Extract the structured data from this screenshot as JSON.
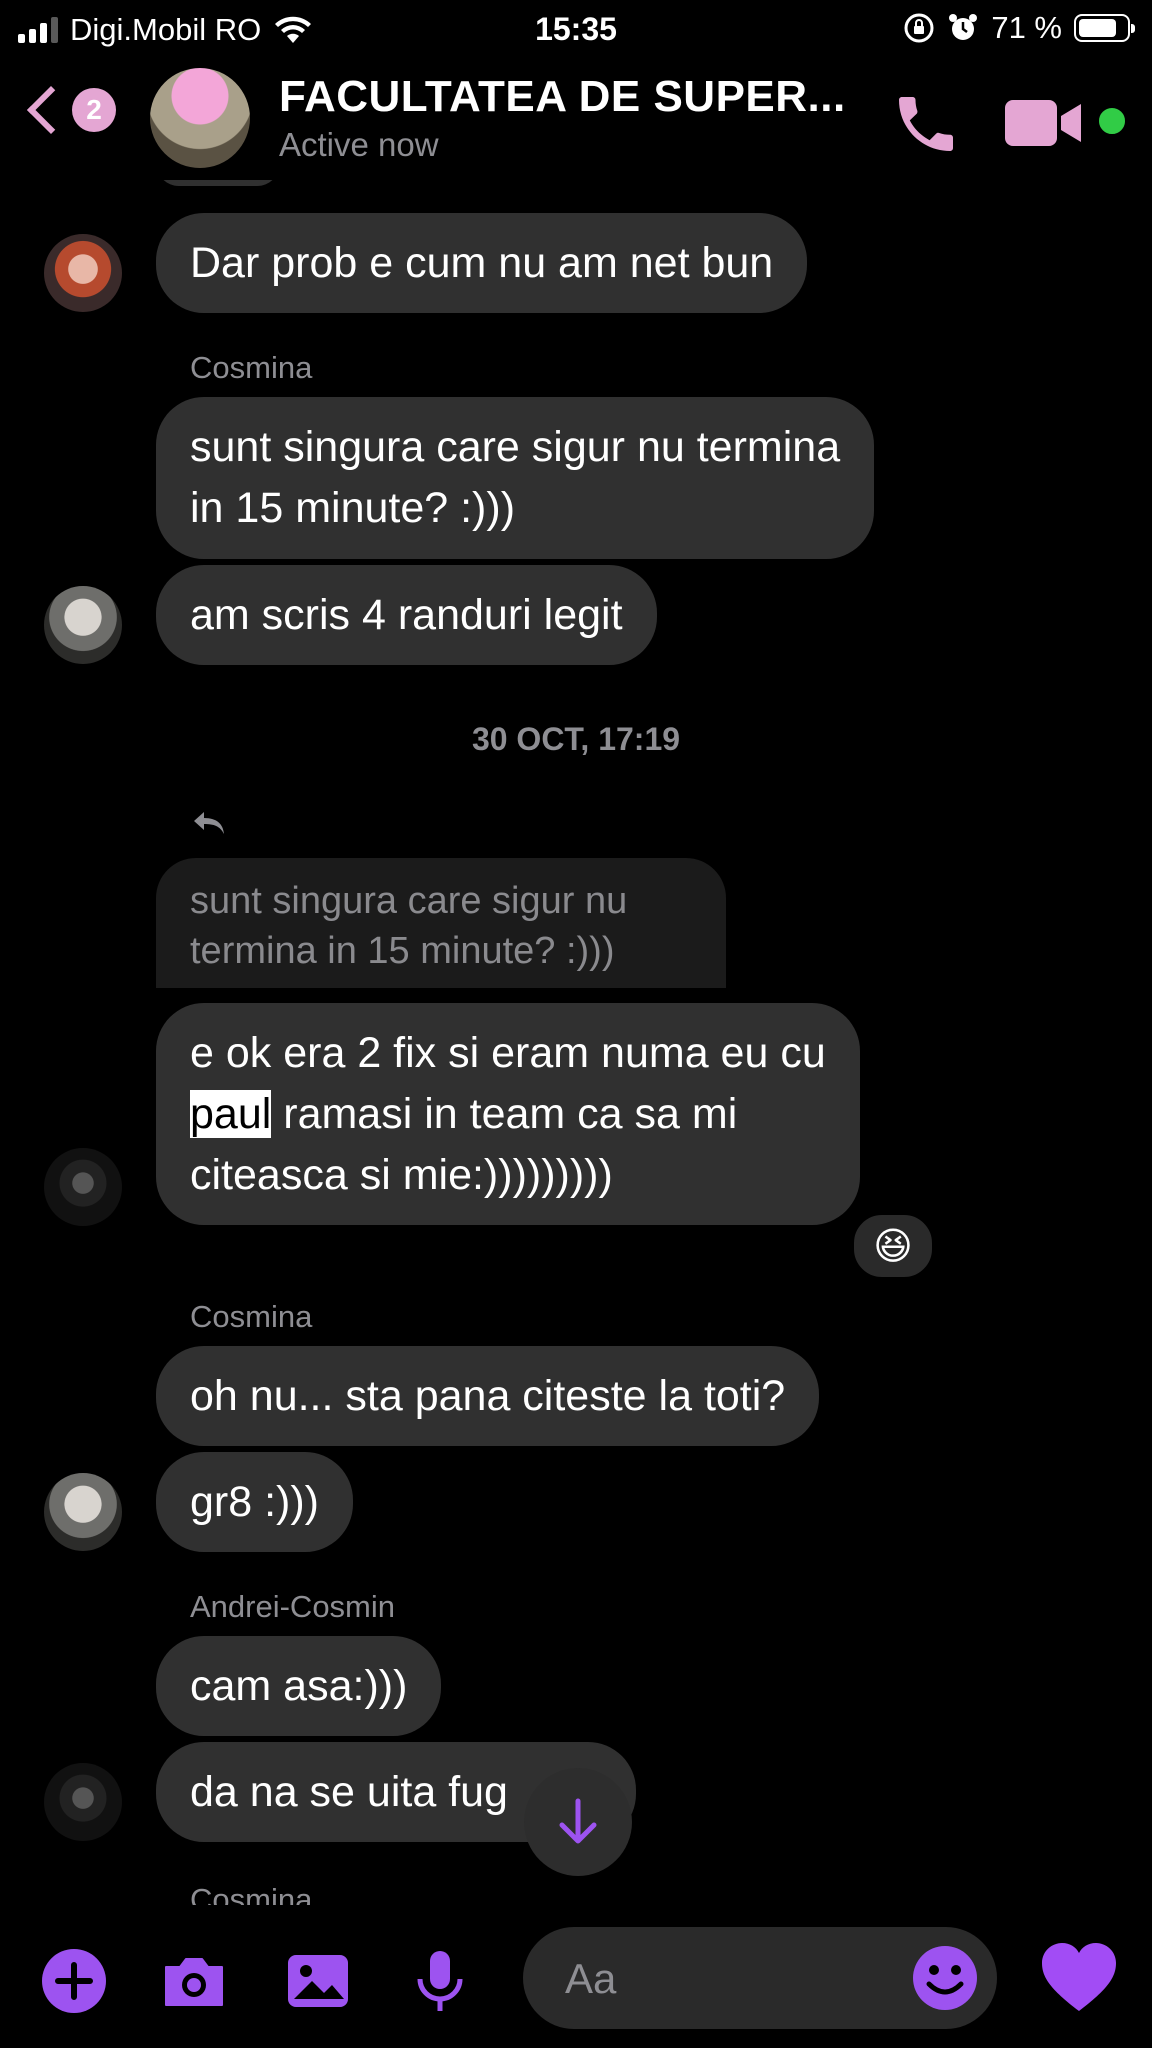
{
  "status_bar": {
    "carrier": "Digi.Mobil RO",
    "time": "15:35",
    "battery": "71 %"
  },
  "header": {
    "back_badge_count": "2",
    "title": "FACULTATEA DE SUPER...",
    "subtitle": "Active now"
  },
  "colors": {
    "accent_pink": "#e4a6d3",
    "accent_purple": "#9d53f0",
    "bubble": "#303030",
    "online": "#31cc46"
  },
  "messages": {
    "m1": "Dar prob e cum nu am net bun",
    "sender_cosmina_1": "Cosmina",
    "m2_line1": "sunt singura care sigur nu termina",
    "m2_line2": "in 15 minute? :)))",
    "m3": "am scris 4 randuri legit",
    "timestamp": "30 OCT, 17:19",
    "quoted_line1": "sunt singura care sigur nu",
    "quoted_line2": "termina in 15 minute? :)))",
    "m4_line1": "e ok era 2 fix si eram numa eu cu",
    "m4_highlight": "paul",
    "m4_line2_rest": " ramasi in team ca sa mi",
    "m4_line3": "citeasca si mie:)))))))))",
    "reaction": "😆",
    "sender_cosmina_2": "Cosmina",
    "m5": "oh nu... sta pana citeste la toti?",
    "m6": "gr8 :)))",
    "sender_andrei": "Andrei-Cosmin",
    "m7": "cam asa:)))",
    "m8": "da na se uita fug",
    "sender_cosmina_3": "Cosmina"
  },
  "composer": {
    "placeholder": "Aa"
  },
  "icons": [
    "plus-icon",
    "camera-icon",
    "gallery-icon",
    "microphone-icon",
    "smile-icon",
    "heart-icon",
    "phone-icon",
    "video-icon",
    "reply-icon",
    "arrow-down-icon"
  ]
}
